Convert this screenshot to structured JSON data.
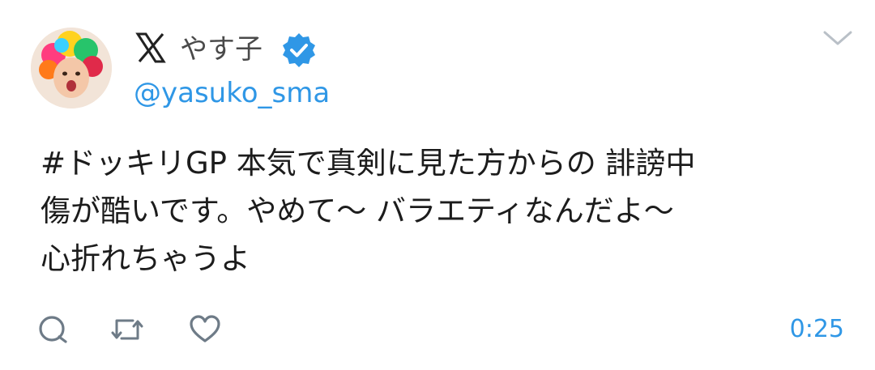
{
  "tweet": {
    "author_name": "やす子",
    "author_handle": "@yasuko_sma",
    "text_lines": [
      "#ドッキリGP 本気で真剣に見た方からの 誹謗中",
      "傷が酷いです。やめて〜 バラエティなんだよ〜",
      "心折れちゃうよ"
    ],
    "timestamp": "0:25",
    "verified": true
  },
  "icons": {
    "platform": "x-logo-icon",
    "verified": "verified-badge-icon",
    "menu": "chevron-down-icon",
    "reply": "reply-icon",
    "retweet": "retweet-icon",
    "like": "heart-icon"
  },
  "colors": {
    "accent": "#2f97e6",
    "text": "#1c1c1c",
    "icon_gray": "#6e7b87"
  }
}
